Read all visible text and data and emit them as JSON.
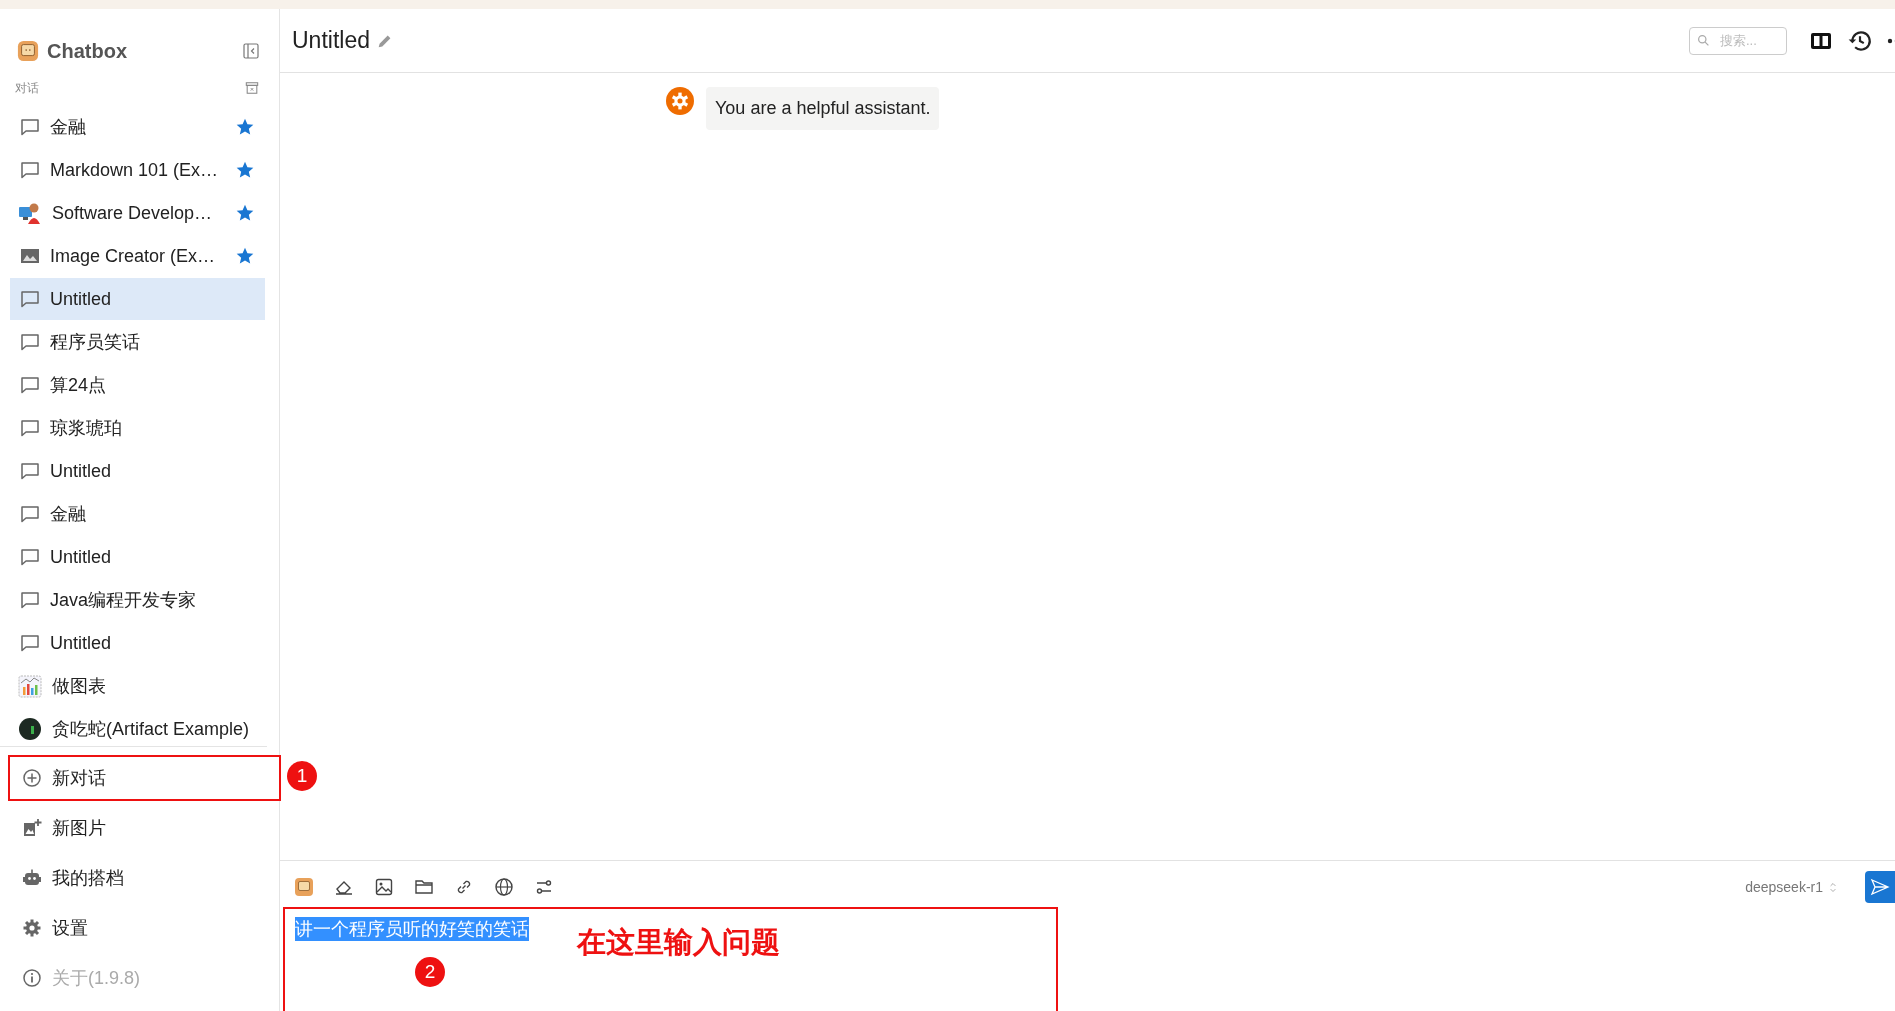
{
  "sidebar": {
    "app_name": "Chatbox",
    "section_label": "对话",
    "conversations": [
      {
        "title": "金融",
        "kind": "chat",
        "starred": true,
        "selected": false
      },
      {
        "title": "Markdown 101 (Ex…",
        "kind": "chat",
        "starred": true,
        "selected": false
      },
      {
        "title": "Software Develop…",
        "kind": "figure",
        "starred": true,
        "selected": false
      },
      {
        "title": "Image Creator (Ex…",
        "kind": "image",
        "starred": true,
        "selected": false
      },
      {
        "title": "Untitled",
        "kind": "chat",
        "starred": false,
        "selected": true
      },
      {
        "title": "程序员笑话",
        "kind": "chat",
        "starred": false,
        "selected": false
      },
      {
        "title": "算24点",
        "kind": "chat",
        "starred": false,
        "selected": false
      },
      {
        "title": "琼浆琥珀",
        "kind": "chat",
        "starred": false,
        "selected": false
      },
      {
        "title": "Untitled",
        "kind": "chat",
        "starred": false,
        "selected": false
      },
      {
        "title": "金融",
        "kind": "chat",
        "starred": false,
        "selected": false
      },
      {
        "title": "Untitled",
        "kind": "chat",
        "starred": false,
        "selected": false
      },
      {
        "title": "Java编程开发专家",
        "kind": "chat",
        "starred": false,
        "selected": false
      },
      {
        "title": "Untitled",
        "kind": "chat",
        "starred": false,
        "selected": false
      },
      {
        "title": "做图表",
        "kind": "chart",
        "starred": false,
        "selected": false
      },
      {
        "title": "贪吃蛇(Artifact Example)",
        "kind": "dark",
        "starred": false,
        "selected": false
      }
    ],
    "actions": [
      {
        "label": "新对话",
        "kind": "new-chat",
        "marker": "1"
      },
      {
        "label": "新图片",
        "kind": "new-image"
      },
      {
        "label": "我的搭档",
        "kind": "partners"
      },
      {
        "label": "设置",
        "kind": "settings"
      },
      {
        "label": "关于(1.9.8)",
        "kind": "about"
      }
    ]
  },
  "header": {
    "title": "Untitled",
    "search": {
      "placeholder": "搜索..."
    }
  },
  "messages": [
    {
      "kind": "system",
      "text": "You are a helpful assistant."
    }
  ],
  "composer": {
    "value": "讲一个程序员听的好笑的笑话",
    "model": "deepseek-r1",
    "marker": "2",
    "annotation": "在这里输入问题"
  }
}
